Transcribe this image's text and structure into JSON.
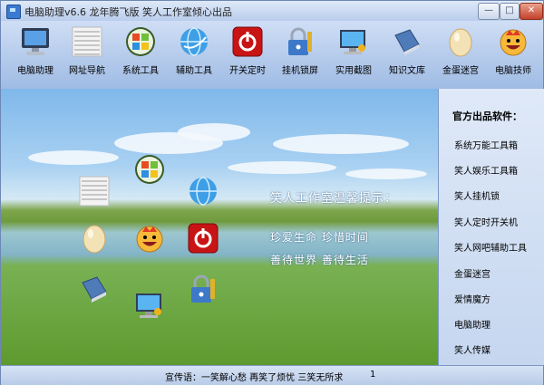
{
  "window": {
    "title": "电脑助理v6.6 龙年腾飞版  笑人工作室倾心出品",
    "min_label": "—",
    "max_label": "□",
    "close_label": "✕"
  },
  "toolbar": {
    "items": [
      {
        "label": "电脑助理",
        "icon": "monitor-icon"
      },
      {
        "label": "网址导航",
        "icon": "grid-pattern-icon"
      },
      {
        "label": "系统工具",
        "icon": "windows-logo-icon"
      },
      {
        "label": "辅助工具",
        "icon": "globe-icon"
      },
      {
        "label": "开关定时",
        "icon": "power-icon"
      },
      {
        "label": "挂机锁屏",
        "icon": "padlock-icon"
      },
      {
        "label": "实用截图",
        "icon": "screen-key-icon"
      },
      {
        "label": "知识文库",
        "icon": "book-icon"
      },
      {
        "label": "金蛋迷宫",
        "icon": "egg-icon"
      },
      {
        "label": "电脑技师",
        "icon": "smiley-face-icon"
      }
    ]
  },
  "notice": {
    "title": "笑人工作室温馨提示：",
    "line1": "珍爱生命   珍惜时间",
    "line2": "善待世界   善待生活"
  },
  "sidebar": {
    "title": "官方出品软件：",
    "items": [
      "系统万能工具箱",
      "笑人娱乐工具箱",
      "笑人挂机锁",
      "笑人定时开关机",
      "笑人网吧辅助工具",
      "金蛋迷宫",
      "爱情魔方",
      "电脑助理",
      "笑人传媒"
    ]
  },
  "statusbar": {
    "text": "宣传语：一笑解心愁   再笑了烦忧   三笑无所求",
    "count": "1"
  },
  "colors": {
    "accent": "#3a7ad0",
    "power_red": "#d42020",
    "xp_green": "#3bb54a",
    "title_bar": "#c7d9f3"
  }
}
